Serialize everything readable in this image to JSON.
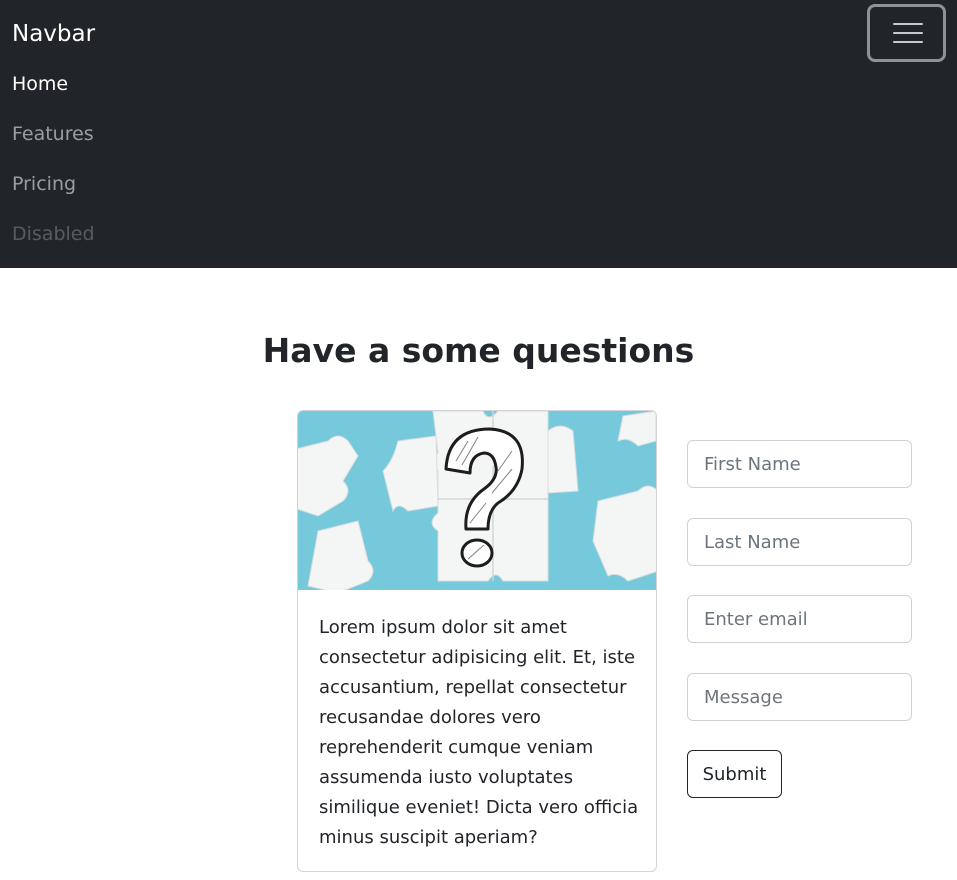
{
  "navbar": {
    "brand": "Navbar",
    "toggler_icon": "hamburger-menu-icon",
    "links": [
      {
        "label": "Home",
        "state": "active"
      },
      {
        "label": "Features",
        "state": "normal"
      },
      {
        "label": "Pricing",
        "state": "normal"
      },
      {
        "label": "Disabled",
        "state": "disabled"
      }
    ]
  },
  "main": {
    "title": "Have a some questions",
    "card": {
      "image": "jigsaw-puzzle-question-mark-image",
      "text": "Lorem ipsum dolor sit amet consectetur adipisicing elit. Et, iste accusantium, repellat consectetur recusandae dolores vero reprehenderit cumque veniam assumenda iusto voluptates similique eveniet! Dicta vero officia minus suscipit aperiam?"
    },
    "form": {
      "first_name_placeholder": "First Name",
      "last_name_placeholder": "Last Name",
      "email_placeholder": "Enter email",
      "message_placeholder": "Message",
      "submit_label": "Submit"
    }
  },
  "colors": {
    "navbar_bg": "#212529",
    "image_bg": "#6cc4d6",
    "field_border": "#cfd3d7"
  }
}
